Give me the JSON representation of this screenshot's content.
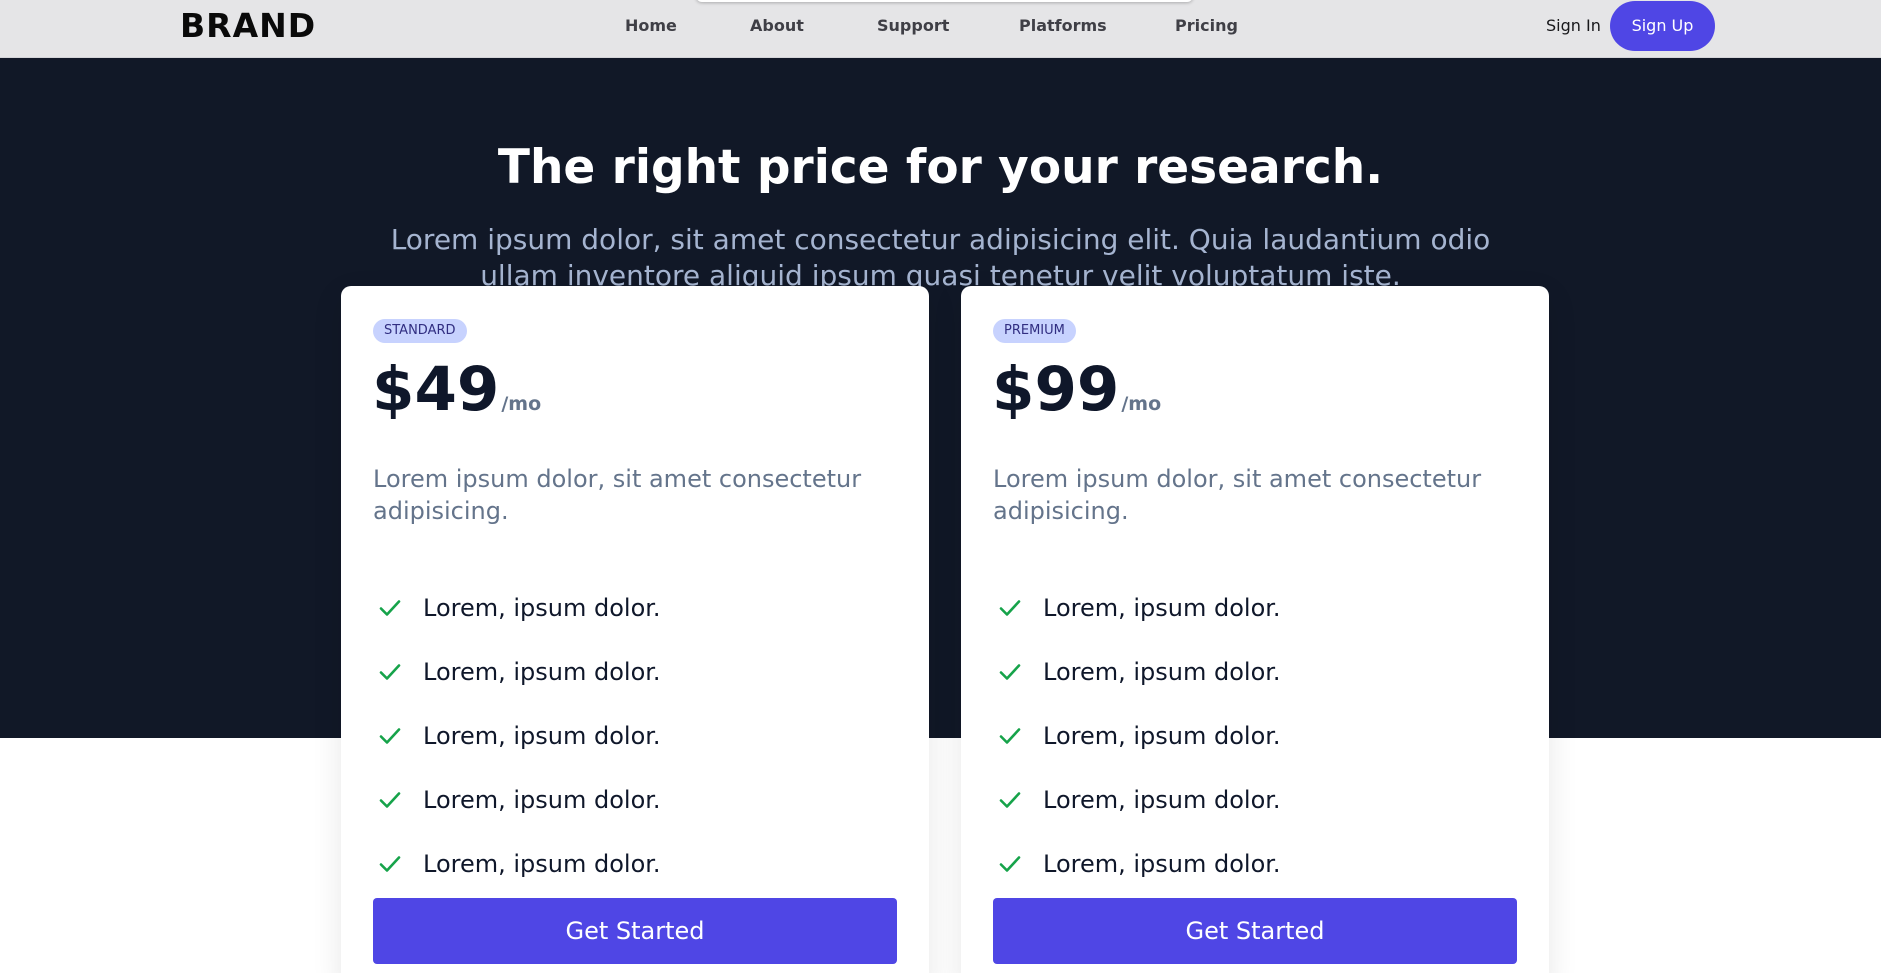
{
  "nav": {
    "brand": "BRAND",
    "links": [
      "Home",
      "About",
      "Support",
      "Platforms",
      "Pricing"
    ],
    "signin": "Sign In",
    "signup": "Sign Up"
  },
  "hero": {
    "title": "The right price for your research.",
    "subtitle": "Lorem ipsum dolor, sit amet consectetur adipisicing elit. Quia laudantium odio ullam inventore aliquid ipsum quasi tenetur velit voluptatum iste."
  },
  "plans": [
    {
      "badge": "Standard",
      "price": "$49",
      "unit": "/mo",
      "description": "Lorem ipsum dolor, sit amet consectetur adipisicing.",
      "features": [
        "Lorem, ipsum dolor.",
        "Lorem, ipsum dolor.",
        "Lorem, ipsum dolor.",
        "Lorem, ipsum dolor.",
        "Lorem, ipsum dolor."
      ],
      "cta": "Get Started"
    },
    {
      "badge": "Premium",
      "price": "$99",
      "unit": "/mo",
      "description": "Lorem ipsum dolor, sit amet consectetur adipisicing.",
      "features": [
        "Lorem, ipsum dolor.",
        "Lorem, ipsum dolor.",
        "Lorem, ipsum dolor.",
        "Lorem, ipsum dolor.",
        "Lorem, ipsum dolor."
      ],
      "cta": "Get Started"
    }
  ],
  "icons": {
    "feature": "check-icon"
  },
  "colors": {
    "accent": "#4f46e5",
    "hero_bg": "#111827",
    "check": "#16a34a",
    "badge_bg": "#c7d2fe"
  }
}
